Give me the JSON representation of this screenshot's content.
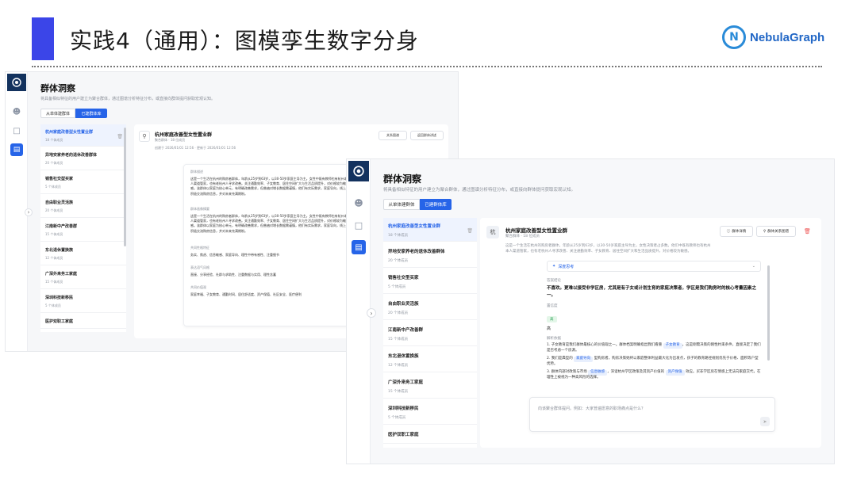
{
  "slide": {
    "title": "实践4（通用）：图模孪生数字分身",
    "logo_text": "NebulaGraph"
  },
  "icons": {
    "rail_logo": "globe-icon",
    "users": "users-icon",
    "chat": "chat-icon",
    "chart": "chart-icon",
    "collapse": "chevron-right-icon"
  },
  "app": {
    "page_title": "群体洞察",
    "page_subtitle": "将具备相似特征的用户建立为聚合群体，通过图谱分析特征分布，或直接向群体提问获取宏观认知。",
    "tabs": [
      "从单体建群体",
      "已建群体库"
    ],
    "groups": [
      {
        "name": "杭州家庭改善型女性置业群",
        "count": "18 个体成员"
      },
      {
        "name": "异地安家养老的退休改善群体",
        "count": "20 个体成员"
      },
      {
        "name": "销售社交型买家",
        "count": "5 个体成员"
      },
      {
        "name": "自由职业灵活族",
        "count": "20 个体成员"
      },
      {
        "name": "江南新中产改善群",
        "count": "15 个体成员"
      },
      {
        "name": "东北退休置换族",
        "count": "12 个体成员"
      },
      {
        "name": "广深外来务工家庭",
        "count": "15 个体成员"
      },
      {
        "name": "深圳科技新移民",
        "count": "5 个体成员"
      },
      {
        "name": "医护双职工家庭",
        "count": ""
      }
    ]
  },
  "back": {
    "detail_title": "杭州家庭改善型女性置业群",
    "detail_meta": "聚合群体 · 18 位成员",
    "detail_time": "创建于 2026/01/01 12:56 · 更新于 2026/01/01 12:56",
    "btn_graph": "关系图谱",
    "btn_back": "返回群体讲述",
    "sections": [
      {
        "label": "群体描述",
        "text": "这是一个生活在杭州的购房者群体，年龄从25岁到63岁，以30-50岁家庭主导为主。女性中既有教师也有杭州本人渠道管家，也有老杭州人寻求改善。关注通勤效率、子女教育、居住空间扩大与生活品质提升，对价格较为敏感。该群体以家庭为核心单元，有明确改善需求，但普遍对增长数据需谨慎，他们有实际需求，家庭导向，线上积极交流购房信息，并对未来充满期盼。"
      },
      {
        "label": "群体画像摘要",
        "text": "这是一个生活在杭州的购房者群体，年龄从25岁到63岁，以30-50岁家庭主导为主。女性中既有教师也有杭州本人渠道管家，也有老杭州人寻求改善。关注通勤效率、子女教育、居住空间扩大与生活品质提升，对价格较为敏感。该群体以家庭为核心单元，有明确改善需求，但普遍对增长数据需谨慎，他们有实际需求，家庭导向，线上积极交流购房信息，并对未来充满期盼。"
      },
      {
        "label": "共同性格特征",
        "text": "务实、焦虑、信息敏感、家庭导向、理性中带有感性、注重细节"
      },
      {
        "label": "表达语气风格",
        "text": "直接、分享经验、社群与求助性、注重数据与实用、理性含蓄"
      },
      {
        "label": "共同价值观",
        "text": "家庭幸福、子女教育、通勤时间、居住舒适度、资产保值、社区安全、医疗便利"
      }
    ]
  },
  "front": {
    "detail_title": "杭州家庭改善型女性置业群",
    "detail_meta": "聚合群体 · 18 位成员",
    "avatar": "杭",
    "btn_detail": "群体详情",
    "btn_graph": "群体关系图谱",
    "desc": "这是一个生活在杭州的购房者群体，年龄从25岁到63岁，以30-50岁家庭主导为主，女性决策者占多数。他们中既有教师也有杭州本人渠道管家，也有老杭州人寻求改善、关注通勤效率、子女教育、居住空间扩大和生活品质提升，对价格较为敏感。",
    "thinking_label": "深度思考",
    "answer_label": "答案结论",
    "answer": "不喜欢。更难以接受非学区房，尤其是有子女或计划生育的家庭决策者，学区是我们购房时的核心考量因素之一。",
    "confidence_label": "置信度",
    "confidence_tag": "高",
    "confidence_value": "高",
    "reasons_label": "解析依据",
    "reasons": [
      {
        "pre": "1. 子女教育是我们群体最核心的价值观之一。群体档案明确指出我们看重 ",
        "tag": "子女教育",
        "post": "，这是刚需决策的刚性约束条件，直接决定了我们是否考虑一个房源。"
      },
      {
        "pre": "2. 我们是典型的 ",
        "tag": "家庭导向",
        "post": " 型购房者，购房决策始终以家庭整体利益最大化为出发点，孩子的教育路径规划优先于价格、面积等户型优势。"
      },
      {
        "pre": "3. 群体内部对政策与市场 ",
        "tag": "信息敏感",
        "post": "，深谙杭州学区政策及其资产价值的 ",
        "tag2": "资产保值",
        "post2": " 效应。买非学区房在情感上无法向家庭交代，在理性上被视为一种高风险的选择。"
      }
    ],
    "ask_placeholder": "向该聚合群体提问。例如：大家普遍愿意的职场痛点是什么？"
  }
}
